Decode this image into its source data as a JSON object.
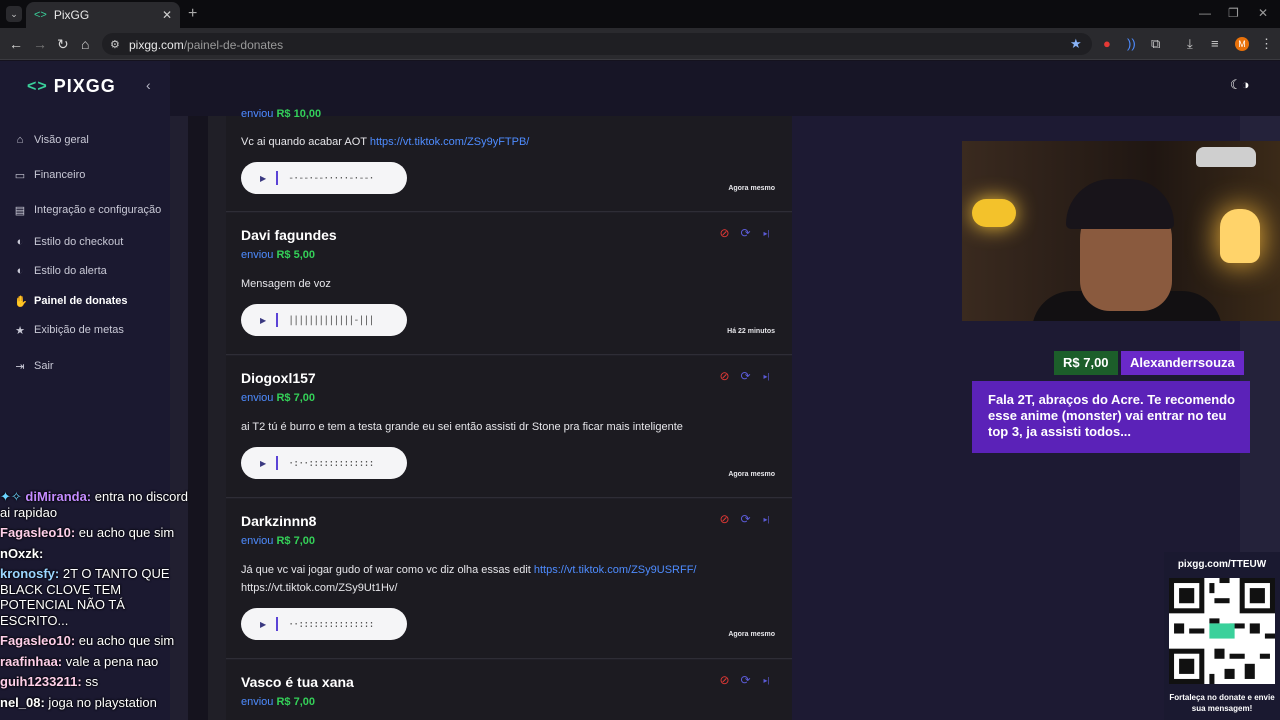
{
  "browser": {
    "tab_title": "PixGG",
    "tab_close": "✕",
    "new_tab": "+",
    "url_host": "pixgg.com",
    "url_path": "/painel-de-donates",
    "profile_initial": "M"
  },
  "sidebar": {
    "logo_text": "PIXGG",
    "items": [
      {
        "label": "Visão geral",
        "icon": "home-icon"
      },
      {
        "label": "Financeiro",
        "icon": "wallet-icon"
      },
      {
        "label": "Integração e configuração",
        "icon": "plug-icon"
      },
      {
        "label": "Estilo do checkout",
        "icon": "palette-icon"
      },
      {
        "label": "Estilo do alerta",
        "icon": "palette-icon"
      },
      {
        "label": "Painel de donates",
        "icon": "hand-coin-icon"
      },
      {
        "label": "Exibição de metas",
        "icon": "star-icon"
      },
      {
        "label": "Sair",
        "icon": "logout-icon"
      }
    ]
  },
  "chat": [
    {
      "user": "diMiranda:",
      "color": "#c38bff",
      "text": "entra no discord ai rapidao"
    },
    {
      "user": "Fagasleo10:",
      "color": "#ffd0ea",
      "text": "eu acho que sim"
    },
    {
      "user": "nOxzk:",
      "color": "#ffffff",
      "text": ""
    },
    {
      "user": "kronosfy:",
      "color": "#9bd6ff",
      "text": "2T O TANTO QUE BLACK CLOVE TEM POTENCIAL NÃO TÁ ESCRITO..."
    },
    {
      "user": "Fagasleo10:",
      "color": "#ffd0ea",
      "text": "eu acho que sim"
    },
    {
      "user": "raafinhaa:",
      "color": "#ffd0ea",
      "text": "vale a pena nao"
    },
    {
      "user": "guih1233211:",
      "color": "#ffd0ea",
      "text": "ss"
    },
    {
      "user": "nel_08:",
      "color": "#ffffff",
      "text": "joga no playstation"
    }
  ],
  "donations": [
    {
      "name": "",
      "sent_prefix": "enviou",
      "amount": "R$ 10,00",
      "message": "Vc ai quando acabar AOT ",
      "link": "https://vt.tiktok.com/ZSy9yFTPB/",
      "extra": "",
      "time": "Agora mesmo"
    },
    {
      "name": "Davi fagundes",
      "sent_prefix": "enviou",
      "amount": "R$ 5,00",
      "message": "Mensagem de voz",
      "link": "",
      "extra": "",
      "time": "Há 22 minutos"
    },
    {
      "name": "Diogoxl157",
      "sent_prefix": "enviou",
      "amount": "R$ 7,00",
      "message": "ai T2 tú é burro e tem a testa grande eu sei então assisti dr Stone pra ficar mais inteligente",
      "link": "",
      "extra": "",
      "time": "Agora mesmo"
    },
    {
      "name": "Darkzinnn8",
      "sent_prefix": "enviou",
      "amount": "R$ 7,00",
      "message": "Já que vc vai jogar gudo of war como vc diz olha essas edit ",
      "link": "https://vt.tiktok.com/ZSy9USRFF/",
      "extra": "https://vt.tiktok.com/ZSy9Ut1Hv/",
      "time": "Agora mesmo"
    },
    {
      "name": "Vasco é tua xana",
      "sent_prefix": "enviou",
      "amount": "R$ 7,00",
      "message": "",
      "link": "",
      "extra": "",
      "time": ""
    }
  ],
  "alert": {
    "amount": "R$ 7,00",
    "name": "Alexanderrsouza",
    "message": "Fala 2T, abraços do Acre. Te recomendo esse anime (monster) vai entrar no teu top 3, ja assisti todos..."
  },
  "qr_widget": {
    "url": "pixgg.com/TTEUW",
    "caption": "Fortaleça no donate e envie sua mensagem!"
  },
  "colors": {
    "accent_purple": "#5b22b8",
    "amount_green": "#34d058",
    "link_blue": "#4e8cff"
  }
}
